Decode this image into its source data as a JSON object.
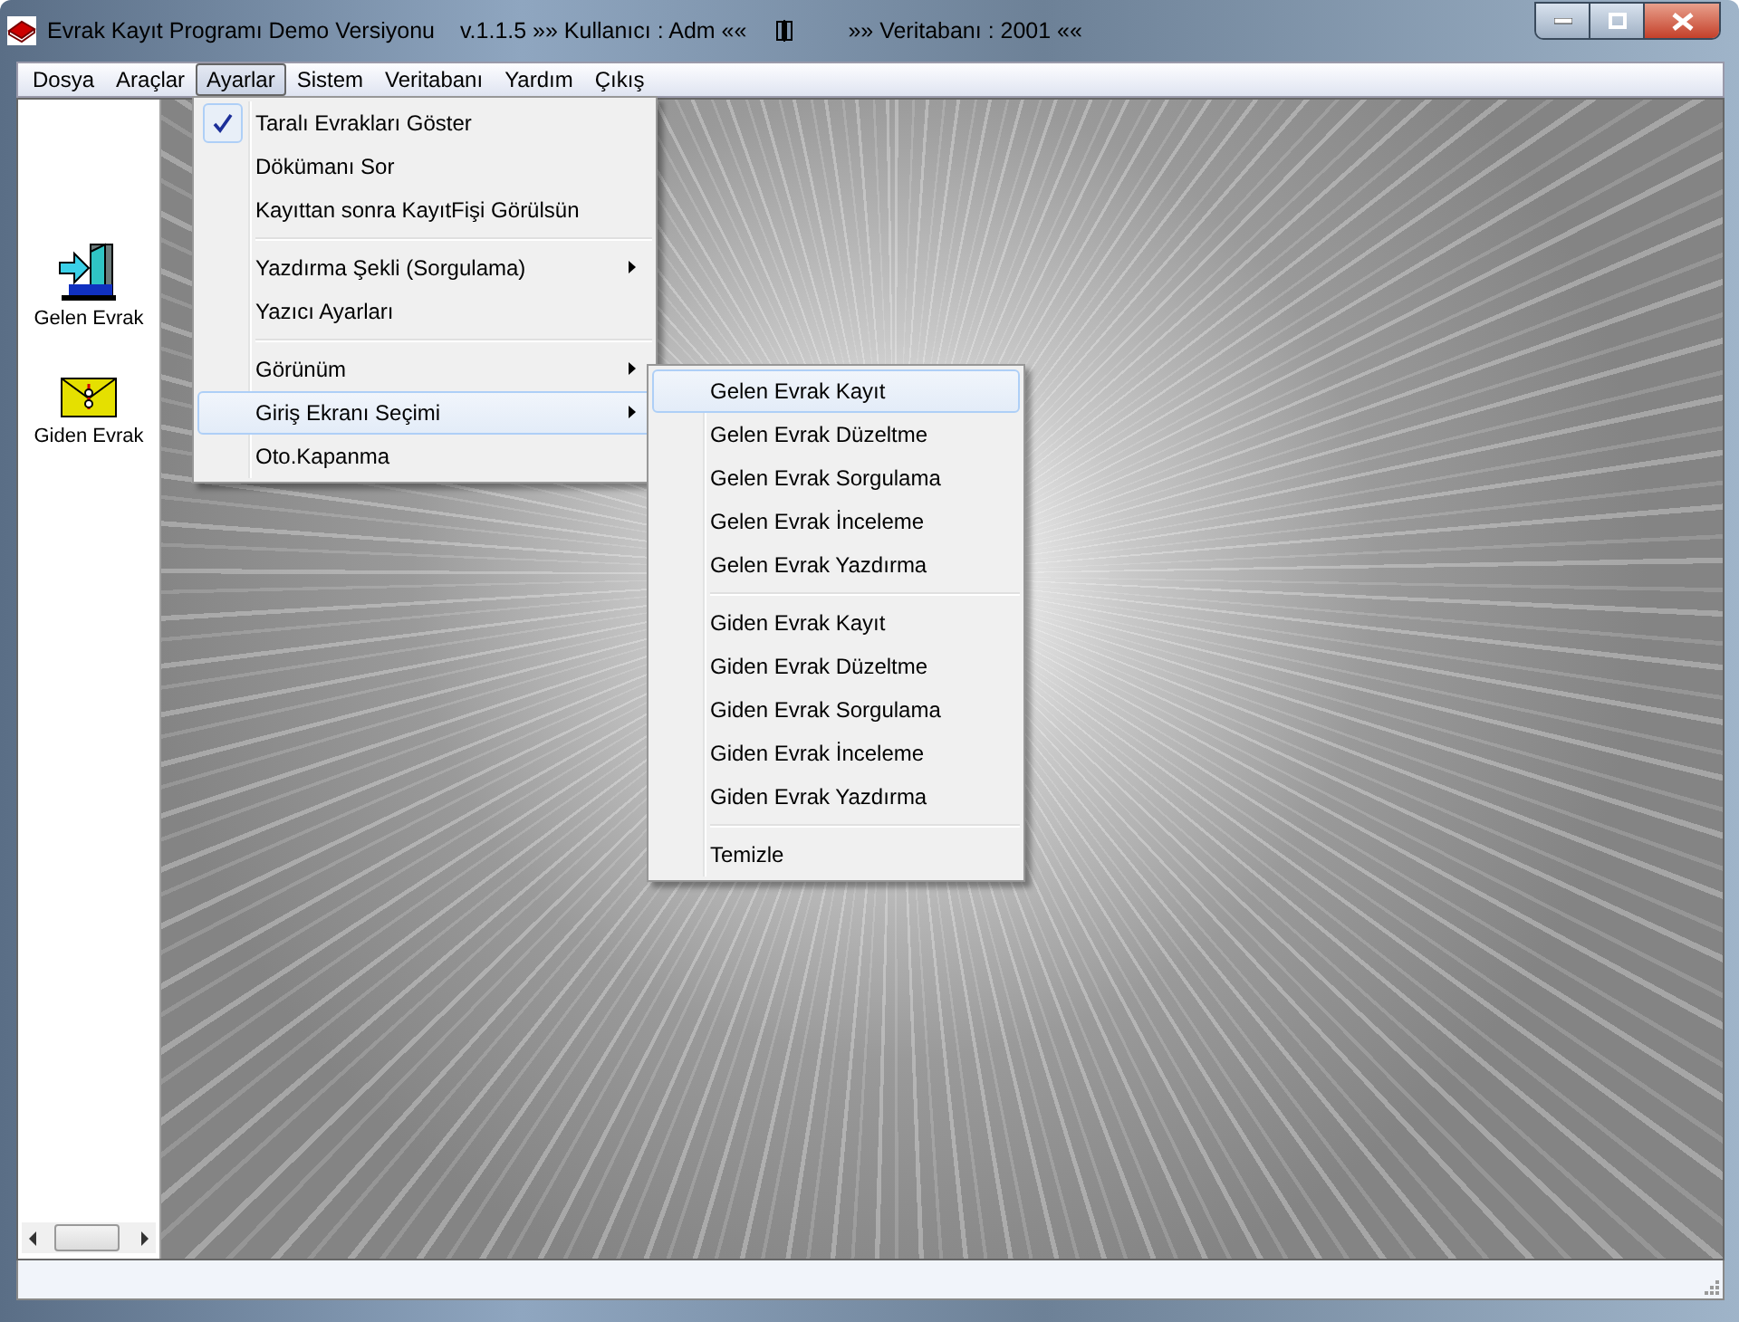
{
  "window": {
    "title": "Evrak Kayıt Programı Demo Versiyonu",
    "version": "v.1.1.5 »»  Kullanıcı : Adm ««",
    "database": "»»  Veritabanı : 2001 ««"
  },
  "menubar": [
    {
      "label": "Dosya",
      "selected": false
    },
    {
      "label": "Araçlar",
      "selected": false
    },
    {
      "label": "Ayarlar",
      "selected": true
    },
    {
      "label": "Sistem",
      "selected": false
    },
    {
      "label": "Veritabanı",
      "selected": false
    },
    {
      "label": "Yardım",
      "selected": false
    },
    {
      "label": "Çıkış",
      "selected": false
    }
  ],
  "dropdown": {
    "groups": [
      [
        {
          "label": "Taralı Evrakları Göster",
          "checked": true,
          "submenu": false,
          "selected": false
        },
        {
          "label": "Dökümanı Sor",
          "checked": false,
          "submenu": false,
          "selected": false
        },
        {
          "label": "Kayıttan sonra KayıtFişi Görülsün",
          "checked": false,
          "submenu": false,
          "selected": false
        }
      ],
      [
        {
          "label": "Yazdırma Şekli (Sorgulama)",
          "checked": false,
          "submenu": true,
          "selected": false
        },
        {
          "label": "Yazıcı Ayarları",
          "checked": false,
          "submenu": false,
          "selected": false
        }
      ],
      [
        {
          "label": "Görünüm",
          "checked": false,
          "submenu": true,
          "selected": false
        },
        {
          "label": "Giriş Ekranı Seçimi",
          "checked": false,
          "submenu": true,
          "selected": true
        },
        {
          "label": "Oto.Kapanma",
          "checked": false,
          "submenu": false,
          "selected": false
        }
      ]
    ]
  },
  "submenu": {
    "groups": [
      [
        {
          "label": "Gelen Evrak Kayıt",
          "selected": true
        },
        {
          "label": "Gelen Evrak Düzeltme",
          "selected": false
        },
        {
          "label": "Gelen Evrak Sorgulama",
          "selected": false
        },
        {
          "label": "Gelen Evrak İnceleme",
          "selected": false
        },
        {
          "label": "Gelen Evrak Yazdırma",
          "selected": false
        }
      ],
      [
        {
          "label": "Giden Evrak Kayıt",
          "selected": false
        },
        {
          "label": "Giden Evrak Düzeltme",
          "selected": false
        },
        {
          "label": "Giden Evrak Sorgulama",
          "selected": false
        },
        {
          "label": "Giden Evrak İnceleme",
          "selected": false
        },
        {
          "label": "Giden Evrak Yazdırma",
          "selected": false
        }
      ],
      [
        {
          "label": "Temizle",
          "selected": false
        }
      ]
    ]
  },
  "sidebar": {
    "items": [
      {
        "label": "Gelen Evrak",
        "kind": "incoming"
      },
      {
        "label": "Giden Evrak",
        "kind": "outgoing"
      }
    ]
  }
}
